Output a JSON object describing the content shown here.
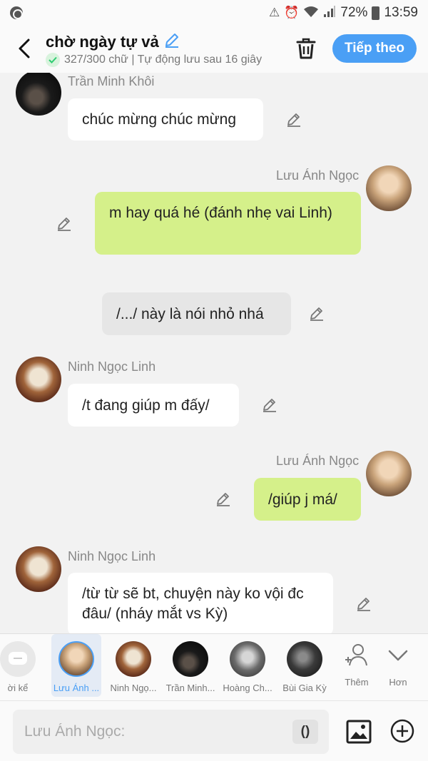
{
  "status": {
    "battery": "72%",
    "time": "13:59",
    "wifi_icon": "wifi-icon",
    "signal_icon": "signal-icon"
  },
  "header": {
    "title": "chờ ngày tự vả",
    "subtitle": "327/300 chữ | Tự động lưu sau 16 giây",
    "next_label": "Tiếp theo"
  },
  "messages": [
    {
      "sender": "Trần Minh Khôi",
      "text": "chúc mừng chúc mừng"
    },
    {
      "sender": "Lưu Ánh Ngọc",
      "text": "m hay quá hé (đánh nhẹ vai Linh)"
    },
    {
      "sender": "",
      "text": "/.../ này là nói nhỏ nhá"
    },
    {
      "sender": "Ninh Ngọc Linh",
      "text": "/t đang giúp m đấy/"
    },
    {
      "sender": "Lưu Ánh Ngọc",
      "text": "/giúp j má/"
    },
    {
      "sender": "Ninh Ngọc Linh",
      "text": "/từ từ sẽ bt, chuyện này ko vội đc đâu/ (nháy mắt vs Kỳ)"
    }
  ],
  "characters": [
    {
      "label": "ời kể"
    },
    {
      "label": "Lưu Ánh ..."
    },
    {
      "label": "Ninh Ngọ..."
    },
    {
      "label": "Trần Minh..."
    },
    {
      "label": "Hoàng Ch..."
    },
    {
      "label": "Bùi Gia Kỳ"
    }
  ],
  "tools": {
    "add_label": "Thêm",
    "more_label": "Hơn"
  },
  "input": {
    "placeholder": "Lưu Ánh Ngọc:",
    "paren_label": "()"
  },
  "colors": {
    "accent": "#4a9ff5",
    "bubble_green": "#d5f08a"
  }
}
